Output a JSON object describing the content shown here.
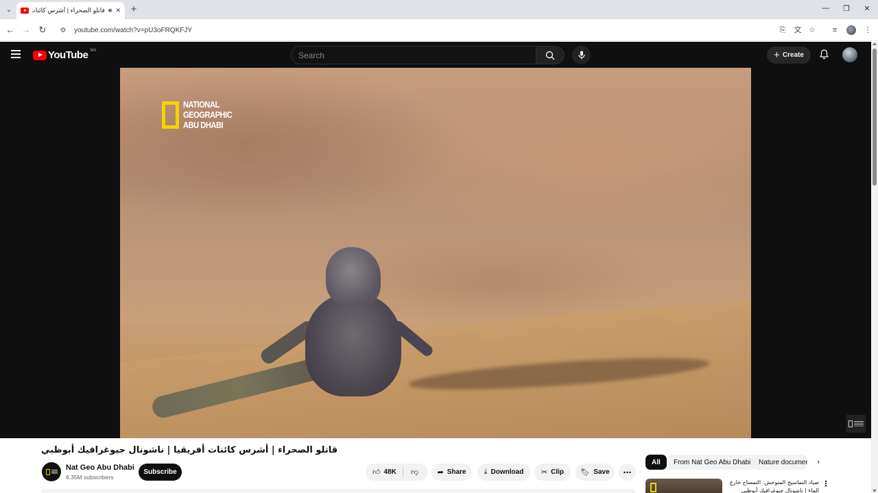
{
  "browser": {
    "tab_title": "قاتلو الصحراء | أشرس كائنات",
    "url": "youtube.com/watch?v=pU3oFRQKFJY",
    "new_tab_symbol": "+",
    "minimize_symbol": "—",
    "restore_symbol": "❐",
    "close_symbol": "✕"
  },
  "masthead": {
    "logo_text": "YouTube",
    "country_code": "MA",
    "search_placeholder": "Search",
    "create_label": "Create"
  },
  "player": {
    "watermark_lines": [
      "NATIONAL",
      "GEOGRAPHIC",
      "ABU DHABI"
    ]
  },
  "video": {
    "title": "قاتلو الصحراء | أشرس كائنات أفريقيا | ناشونال جيوغرافيك أبوظبي",
    "channel_name": "Nat Geo Abu Dhabi",
    "subscribers": "6.35M subscribers",
    "subscribe_label": "Subscribe",
    "likes": "48K",
    "share_label": "Share",
    "download_label": "Download",
    "clip_label": "Clip",
    "save_label": "Save"
  },
  "sidebar": {
    "chips": [
      "All",
      "From Nat Geo Abu Dhabi",
      "Nature documen"
    ],
    "recommendations": [
      {
        "title": "صياد التماسيح المتوحش: التمساح خارج الماء | ناشونال جيوغرافيك أبوظبي"
      }
    ]
  },
  "colors": {
    "youtube_red": "#ff0000",
    "natgeo_yellow": "#f5d400",
    "dark_bg": "#0f0f0f"
  }
}
